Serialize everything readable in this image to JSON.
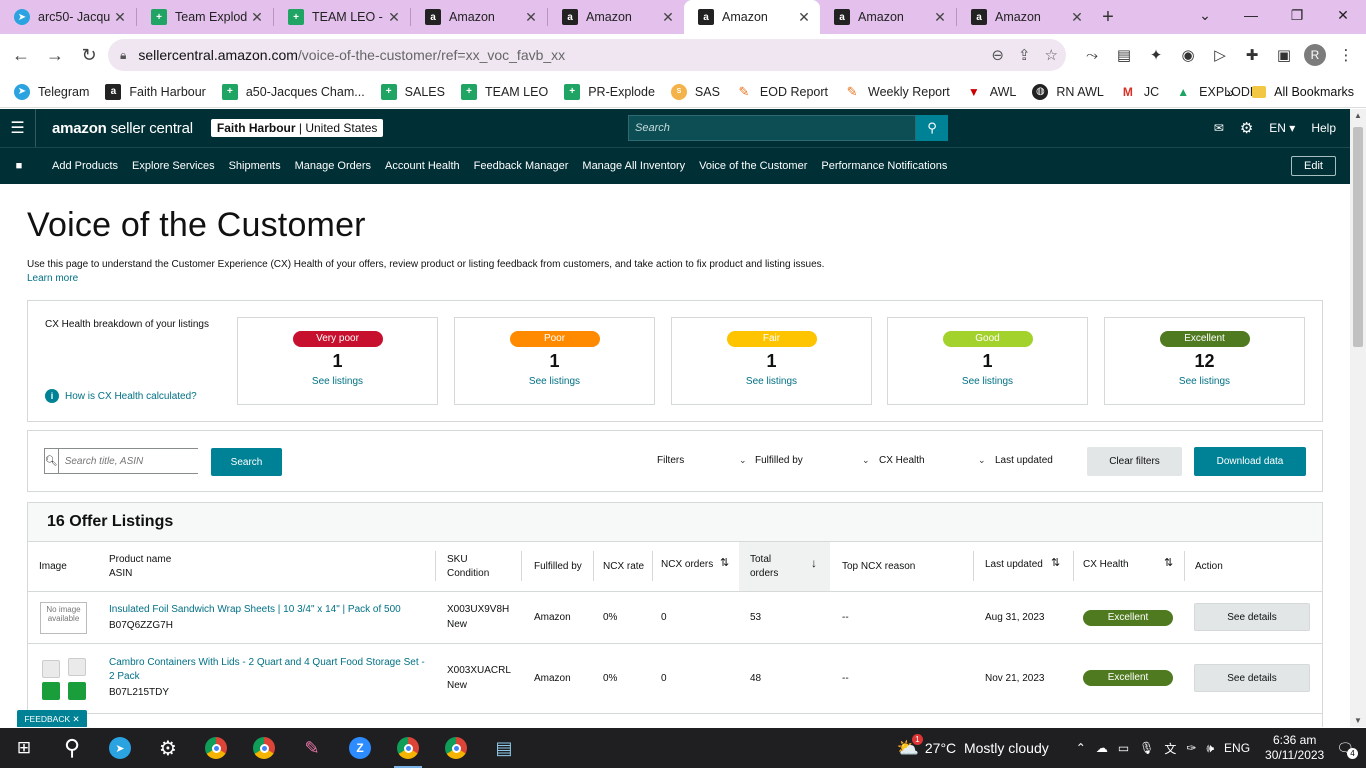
{
  "browser": {
    "tabs": [
      {
        "label": "arc50- Jacqu",
        "icon": "telegram-icon",
        "active": false
      },
      {
        "label": "Team Explod",
        "icon": "sheets-icon",
        "active": false
      },
      {
        "label": "TEAM LEO - (",
        "icon": "sheets-icon",
        "active": false
      },
      {
        "label": "Amazon",
        "icon": "amazon-icon",
        "active": false
      },
      {
        "label": "Amazon",
        "icon": "amazon-icon",
        "active": false
      },
      {
        "label": "Amazon",
        "icon": "amazon-icon",
        "active": true
      },
      {
        "label": "Amazon",
        "icon": "amazon-icon",
        "active": false
      },
      {
        "label": "Amazon",
        "icon": "amazon-icon",
        "active": false
      }
    ],
    "url_host": "sellercentral.amazon.com",
    "url_path": "/voice-of-the-customer/ref=xx_voc_favb_xx",
    "profile_initial": "R",
    "bookmarks": [
      {
        "label": "Telegram",
        "icon": "telegram-icon"
      },
      {
        "label": "Faith Harbour",
        "icon": "amazon-icon"
      },
      {
        "label": "a50-Jacques Cham...",
        "icon": "sheets-icon"
      },
      {
        "label": "SALES",
        "icon": "sheets-icon"
      },
      {
        "label": "TEAM LEO",
        "icon": "sheets-icon"
      },
      {
        "label": "PR-Explode",
        "icon": "sheets-icon"
      },
      {
        "label": "SAS",
        "icon": "sas-icon"
      },
      {
        "label": "EOD Report",
        "icon": "pencil-icon"
      },
      {
        "label": "Weekly Report",
        "icon": "pencil-icon"
      },
      {
        "label": "AWL",
        "icon": "awl-icon"
      },
      {
        "label": "RN AWL",
        "icon": "globe-icon"
      },
      {
        "label": "JC",
        "icon": "gmail-icon"
      },
      {
        "label": "EXPLODE",
        "icon": "drive-icon"
      }
    ],
    "all_bookmarks": "All Bookmarks"
  },
  "header": {
    "logo_brand": "amazon",
    "logo_product": "seller central",
    "store": "Faith Harbour",
    "marketplace": "United States",
    "search_placeholder": "Search",
    "language": "EN",
    "help": "Help"
  },
  "nav": {
    "items": [
      "Add Products",
      "Explore Services",
      "Shipments",
      "Manage Orders",
      "Account Health",
      "Feedback Manager",
      "Manage All Inventory",
      "Voice of the Customer",
      "Performance Notifications"
    ],
    "edit": "Edit"
  },
  "page": {
    "title": "Voice of the Customer",
    "intro": "Use this page to understand the Customer Experience (CX) Health of your offers, review product or listing feedback from customers, and take action to fix product and listing issues.",
    "learn_more": "Learn more"
  },
  "cx_health": {
    "caption": "CX Health breakdown of your listings",
    "how_link": "How is CX Health calculated?",
    "cards": [
      {
        "label": "Very poor",
        "count": "1",
        "link": "See listings",
        "color": "#c7102d",
        "text_color": "#ffffff"
      },
      {
        "label": "Poor",
        "count": "1",
        "link": "See listings",
        "color": "#ff8a00",
        "text_color": "#ffffff"
      },
      {
        "label": "Fair",
        "count": "1",
        "link": "See listings",
        "color": "#ffc400",
        "text_color": "#ffffff"
      },
      {
        "label": "Good",
        "count": "1",
        "link": "See listings",
        "color": "#a4d22c",
        "text_color": "#ffffff"
      },
      {
        "label": "Excellent",
        "count": "12",
        "link": "See listings",
        "color": "#4f7a1f",
        "text_color": "#ffffff"
      }
    ]
  },
  "filters": {
    "search_placeholder": "Search title, ASIN",
    "search_button": "Search",
    "filters_label": "Filters",
    "fulfilled_by": "Fulfilled by",
    "cx_health": "CX Health",
    "last_updated": "Last updated",
    "clear": "Clear filters",
    "download": "Download data"
  },
  "listings": {
    "title": "16 Offer Listings",
    "columns": {
      "image": "Image",
      "product": "Product name",
      "asin": "ASIN",
      "sku": "SKU",
      "condition": "Condition",
      "fulfilled": "Fulfilled by",
      "ncx_rate": "NCX rate",
      "ncx_orders": "NCX orders",
      "total": "Total",
      "orders": "orders",
      "top_reason": "Top NCX reason",
      "last_updated": "Last updated",
      "cx_health": "CX Health",
      "action": "Action"
    },
    "rows": [
      {
        "image_text": "No image available",
        "product": "Insulated Foil Sandwich Wrap Sheets | 10 3/4\" x 14\" | Pack of 500",
        "asin": "B07Q6ZZG7H",
        "sku": "X003UX9V8H",
        "condition": "New",
        "fulfilled": "Amazon",
        "ncx_rate": "0%",
        "ncx_orders": "0",
        "total_orders": "53",
        "top_reason": "--",
        "last_updated": "Aug 31, 2023",
        "cx_health": "Excellent",
        "action": "See details"
      },
      {
        "image_text": "",
        "product": "Cambro Containers With Lids - 2 Quart and 4 Quart Food Storage Set - 2 Pack",
        "asin": "B07L215TDY",
        "sku": "X003XUACRL",
        "condition": "New",
        "fulfilled": "Amazon",
        "ncx_rate": "0%",
        "ncx_orders": "0",
        "total_orders": "48",
        "top_reason": "--",
        "last_updated": "Nov 21, 2023",
        "cx_health": "Excellent",
        "action": "See details"
      }
    ]
  },
  "feedback_tab": "FEEDBACK",
  "taskbar": {
    "temperature": "27°C",
    "weather": "Mostly cloudy",
    "weather_badge": "1",
    "language": "ENG",
    "time": "6:36 am",
    "date": "30/11/2023",
    "notifications": "4"
  }
}
